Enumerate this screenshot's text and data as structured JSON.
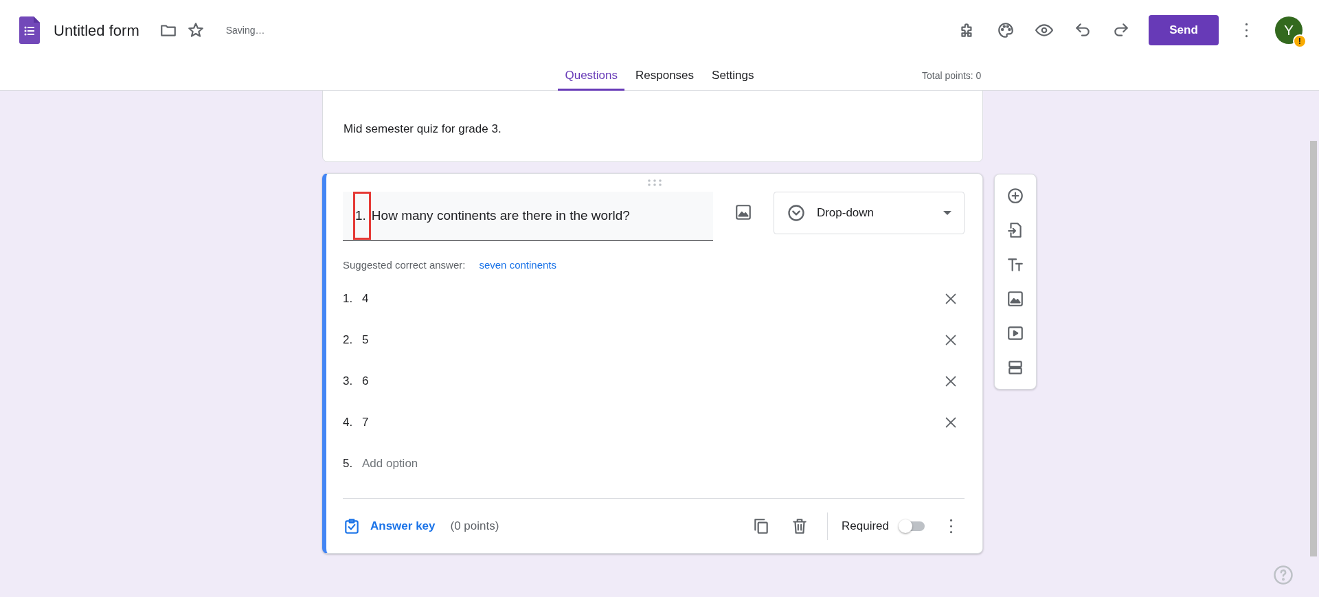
{
  "header": {
    "title": "Untitled form",
    "status": "Saving…",
    "send_label": "Send",
    "avatar_letter": "Y",
    "avatar_badge": "!"
  },
  "tabs": [
    {
      "label": "Questions",
      "selected": true
    },
    {
      "label": "Responses",
      "selected": false
    },
    {
      "label": "Settings",
      "selected": false
    }
  ],
  "total_points": "Total points: 0",
  "form_header": {
    "description": "Mid semester quiz for grade 3."
  },
  "question": {
    "number": "1.",
    "number_highlighted": true,
    "text": "How many continents are there in the world?",
    "type": "Drop-down",
    "suggested_label": "Suggested correct answer:",
    "suggested_value": "seven continents",
    "options": [
      {
        "number": "1.",
        "label": "4",
        "kind": "option"
      },
      {
        "number": "2.",
        "label": "5",
        "kind": "option"
      },
      {
        "number": "3.",
        "label": "6",
        "kind": "option"
      },
      {
        "number": "4.",
        "label": "7",
        "kind": "option"
      },
      {
        "number": "5.",
        "label": "Add option",
        "kind": "add"
      }
    ],
    "answer_key": "Answer key",
    "points": "(0 points)",
    "required_label": "Required",
    "required": false
  }
}
